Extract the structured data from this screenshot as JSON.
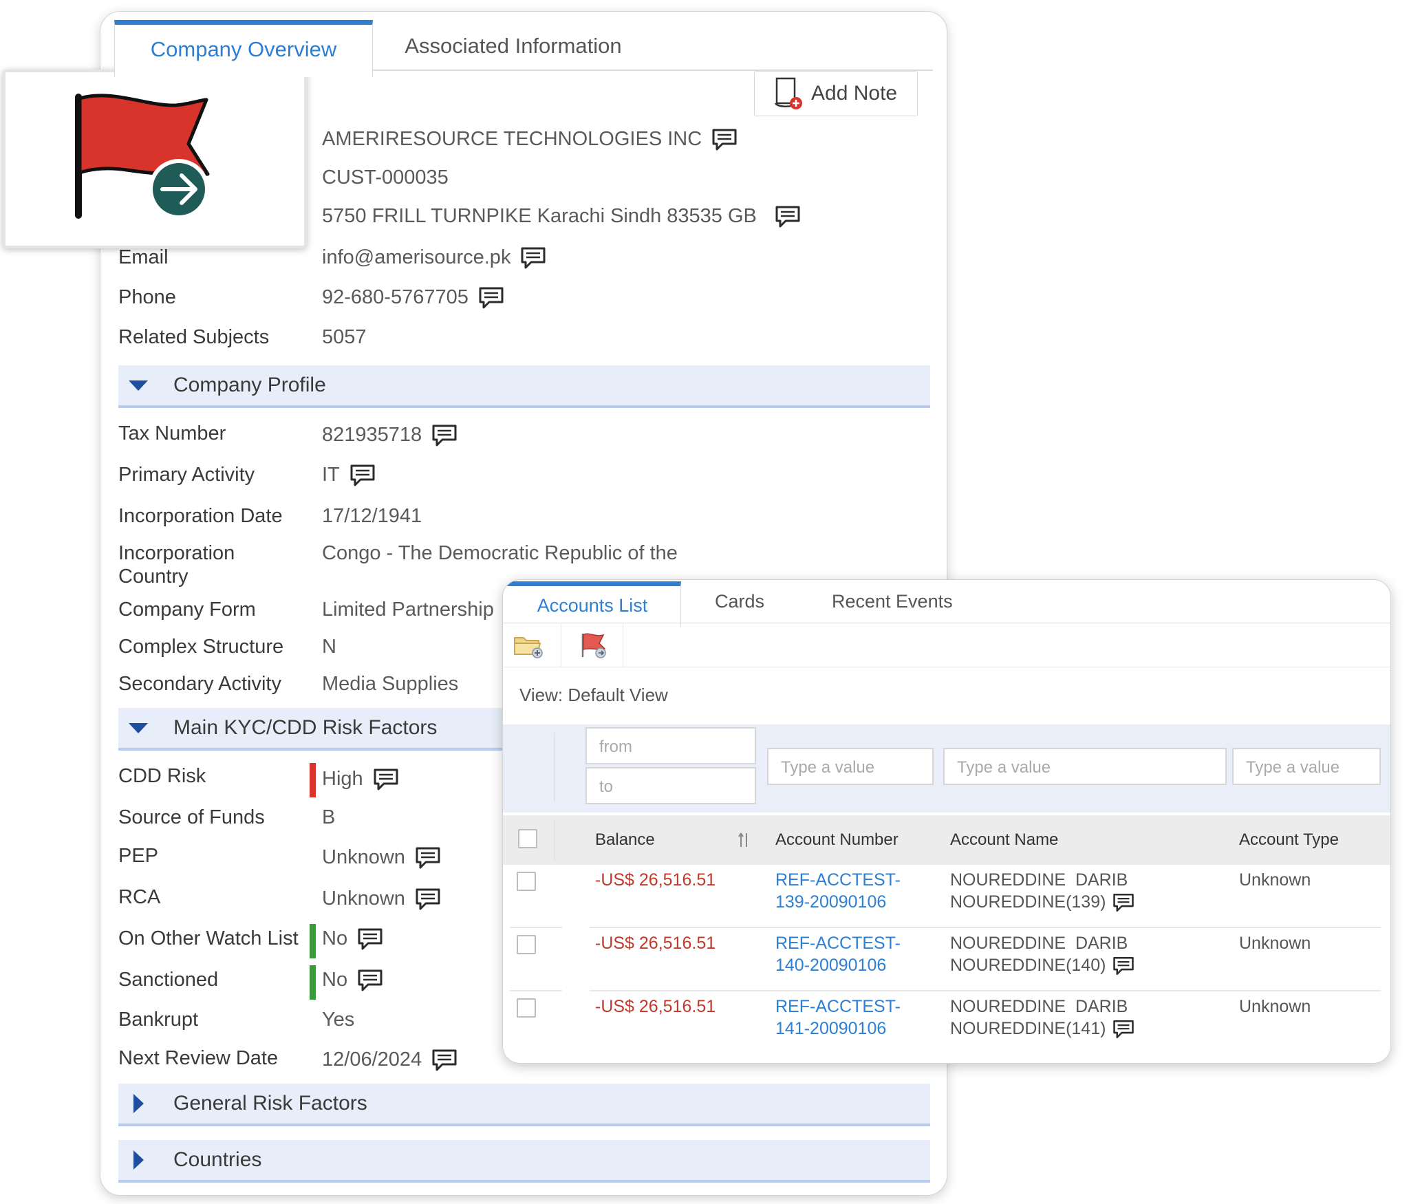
{
  "tabs": {
    "overview": "Company Overview",
    "associated": "Associated Information"
  },
  "add_note": "Add Note",
  "company": {
    "name": "AMERIRESOURCE TECHNOLOGIES INC",
    "id": "CUST-000035",
    "address": "5750 FRILL TURNPIKE Karachi Sindh 83535 GB"
  },
  "fields": {
    "email": {
      "label": "Email",
      "value": "info@amerisource.pk"
    },
    "phone": {
      "label": "Phone",
      "value": "92-680-5767705"
    },
    "related": {
      "label": "Related Subjects",
      "value": "5057"
    }
  },
  "sections": {
    "profile": "Company Profile",
    "kyc": "Main KYC/CDD Risk Factors",
    "general": "General Risk Factors",
    "countries": "Countries"
  },
  "profile": {
    "tax": {
      "label": "Tax Number",
      "value": "821935718"
    },
    "primary": {
      "label": "Primary Activity",
      "value": "IT"
    },
    "inc_date": {
      "label": "Incorporation Date",
      "value": "17/12/1941"
    },
    "inc_country": {
      "label1": "Incorporation",
      "label2": "Country",
      "value": "Congo - The Democratic Republic of the"
    },
    "form": {
      "label": "Company Form",
      "value": "Limited Partnership"
    },
    "complex": {
      "label": "Complex Structure",
      "value": "N"
    },
    "secondary": {
      "label": "Secondary Activity",
      "value": "Media Supplies"
    }
  },
  "kyc": {
    "cdd": {
      "label": "CDD Risk",
      "value": "High"
    },
    "funds": {
      "label": "Source of Funds",
      "value": "B"
    },
    "pep": {
      "label": "PEP",
      "value": "Unknown"
    },
    "rca": {
      "label": "RCA",
      "value": "Unknown"
    },
    "watch": {
      "label": "On Other Watch List",
      "value": "No"
    },
    "sanctioned": {
      "label": "Sanctioned",
      "value": "No"
    },
    "bankrupt": {
      "label": "Bankrupt",
      "value": "Yes"
    },
    "review": {
      "label": "Next Review Date",
      "value": "12/06/2024"
    }
  },
  "colors": {
    "accent": "#2f7fd2",
    "high": "#d9342b",
    "ok": "#3a9a3a",
    "negative": "#c0392b",
    "flag": "#d9342b",
    "arrow": "#1f5b57"
  },
  "accounts": {
    "tabs": {
      "list": "Accounts List",
      "cards": "Cards",
      "events": "Recent Events"
    },
    "view": "View: Default View",
    "filters": {
      "from": "from",
      "to": "to",
      "placeholder": "Type a value"
    },
    "headers": {
      "balance": "Balance",
      "number": "Account Number",
      "name": "Account Name",
      "type": "Account Type"
    },
    "rows": [
      {
        "balance": "-US$ 26,516.51",
        "num1": "REF-ACCTEST-",
        "num2": "139-20090106",
        "name1": "NOUREDDINE  DARIB",
        "name2": "NOUREDDINE(139)",
        "type": "Unknown"
      },
      {
        "balance": "-US$ 26,516.51",
        "num1": "REF-ACCTEST-",
        "num2": "140-20090106",
        "name1": "NOUREDDINE  DARIB",
        "name2": "NOUREDDINE(140)",
        "type": "Unknown"
      },
      {
        "balance": "-US$ 26,516.51",
        "num1": "REF-ACCTEST-",
        "num2": "141-20090106",
        "name1": "NOUREDDINE  DARIB",
        "name2": "NOUREDDINE(141)",
        "type": "Unknown"
      }
    ]
  }
}
